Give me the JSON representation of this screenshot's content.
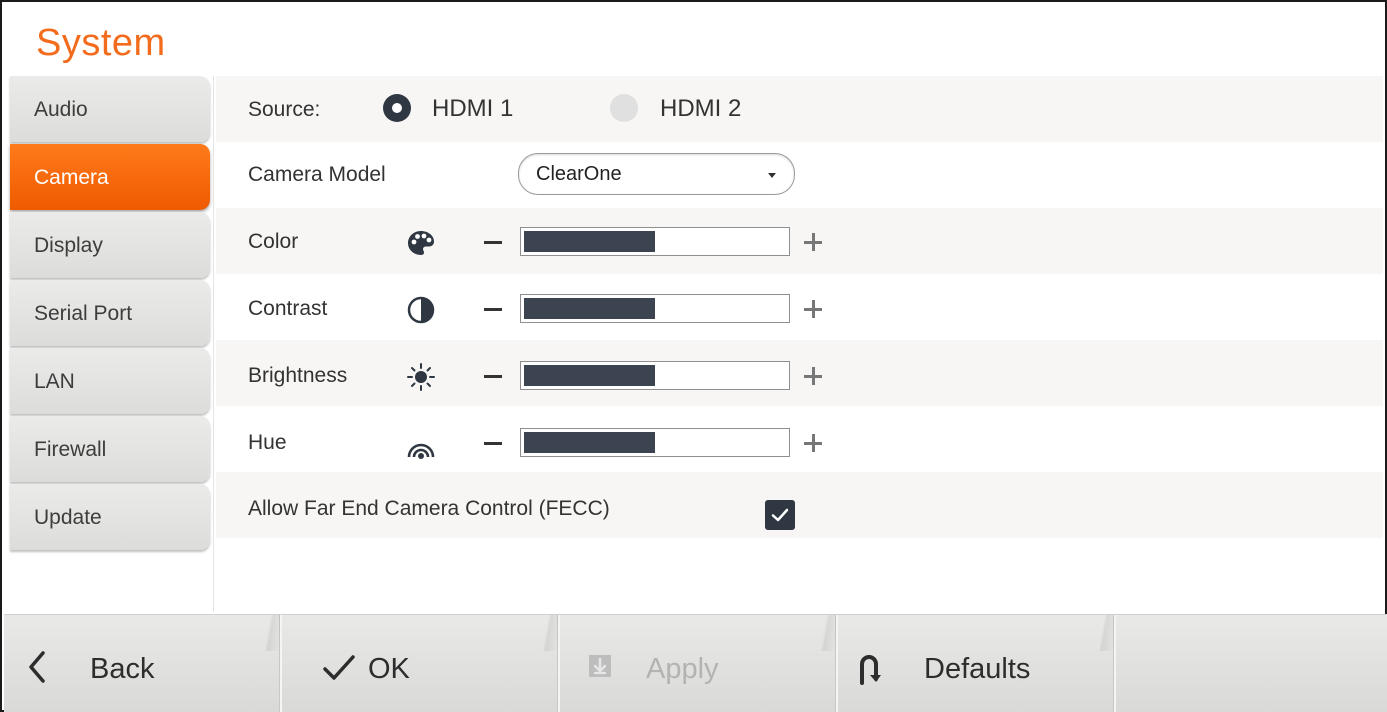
{
  "page": {
    "title": "System"
  },
  "sidebar": {
    "items": [
      {
        "label": "Audio"
      },
      {
        "label": "Camera"
      },
      {
        "label": "Display"
      },
      {
        "label": "Serial Port"
      },
      {
        "label": "LAN"
      },
      {
        "label": "Firewall"
      },
      {
        "label": "Update"
      }
    ],
    "active_index": 1
  },
  "camera": {
    "source_label": "Source:",
    "source_options": [
      "HDMI 1",
      "HDMI 2"
    ],
    "source_selected": "HDMI 1",
    "camera_model_label": "Camera Model",
    "camera_model_value": "ClearOne",
    "sliders": [
      {
        "label": "Color",
        "icon": "palette-icon",
        "level": 0.5
      },
      {
        "label": "Contrast",
        "icon": "contrast-icon",
        "level": 0.5
      },
      {
        "label": "Brightness",
        "icon": "sun-icon",
        "level": 0.5
      },
      {
        "label": "Hue",
        "icon": "hue-icon",
        "level": 0.5
      }
    ],
    "fecc_label": "Allow Far End Camera Control (FECC)",
    "fecc_checked": true
  },
  "bottom_bar": {
    "back_label": "Back",
    "ok_label": "OK",
    "apply_label": "Apply",
    "apply_enabled": false,
    "defaults_label": "Defaults"
  },
  "colors": {
    "accent": "#f36b1c",
    "control_dark": "#2f3842",
    "slider_fill": "#3b4450"
  }
}
